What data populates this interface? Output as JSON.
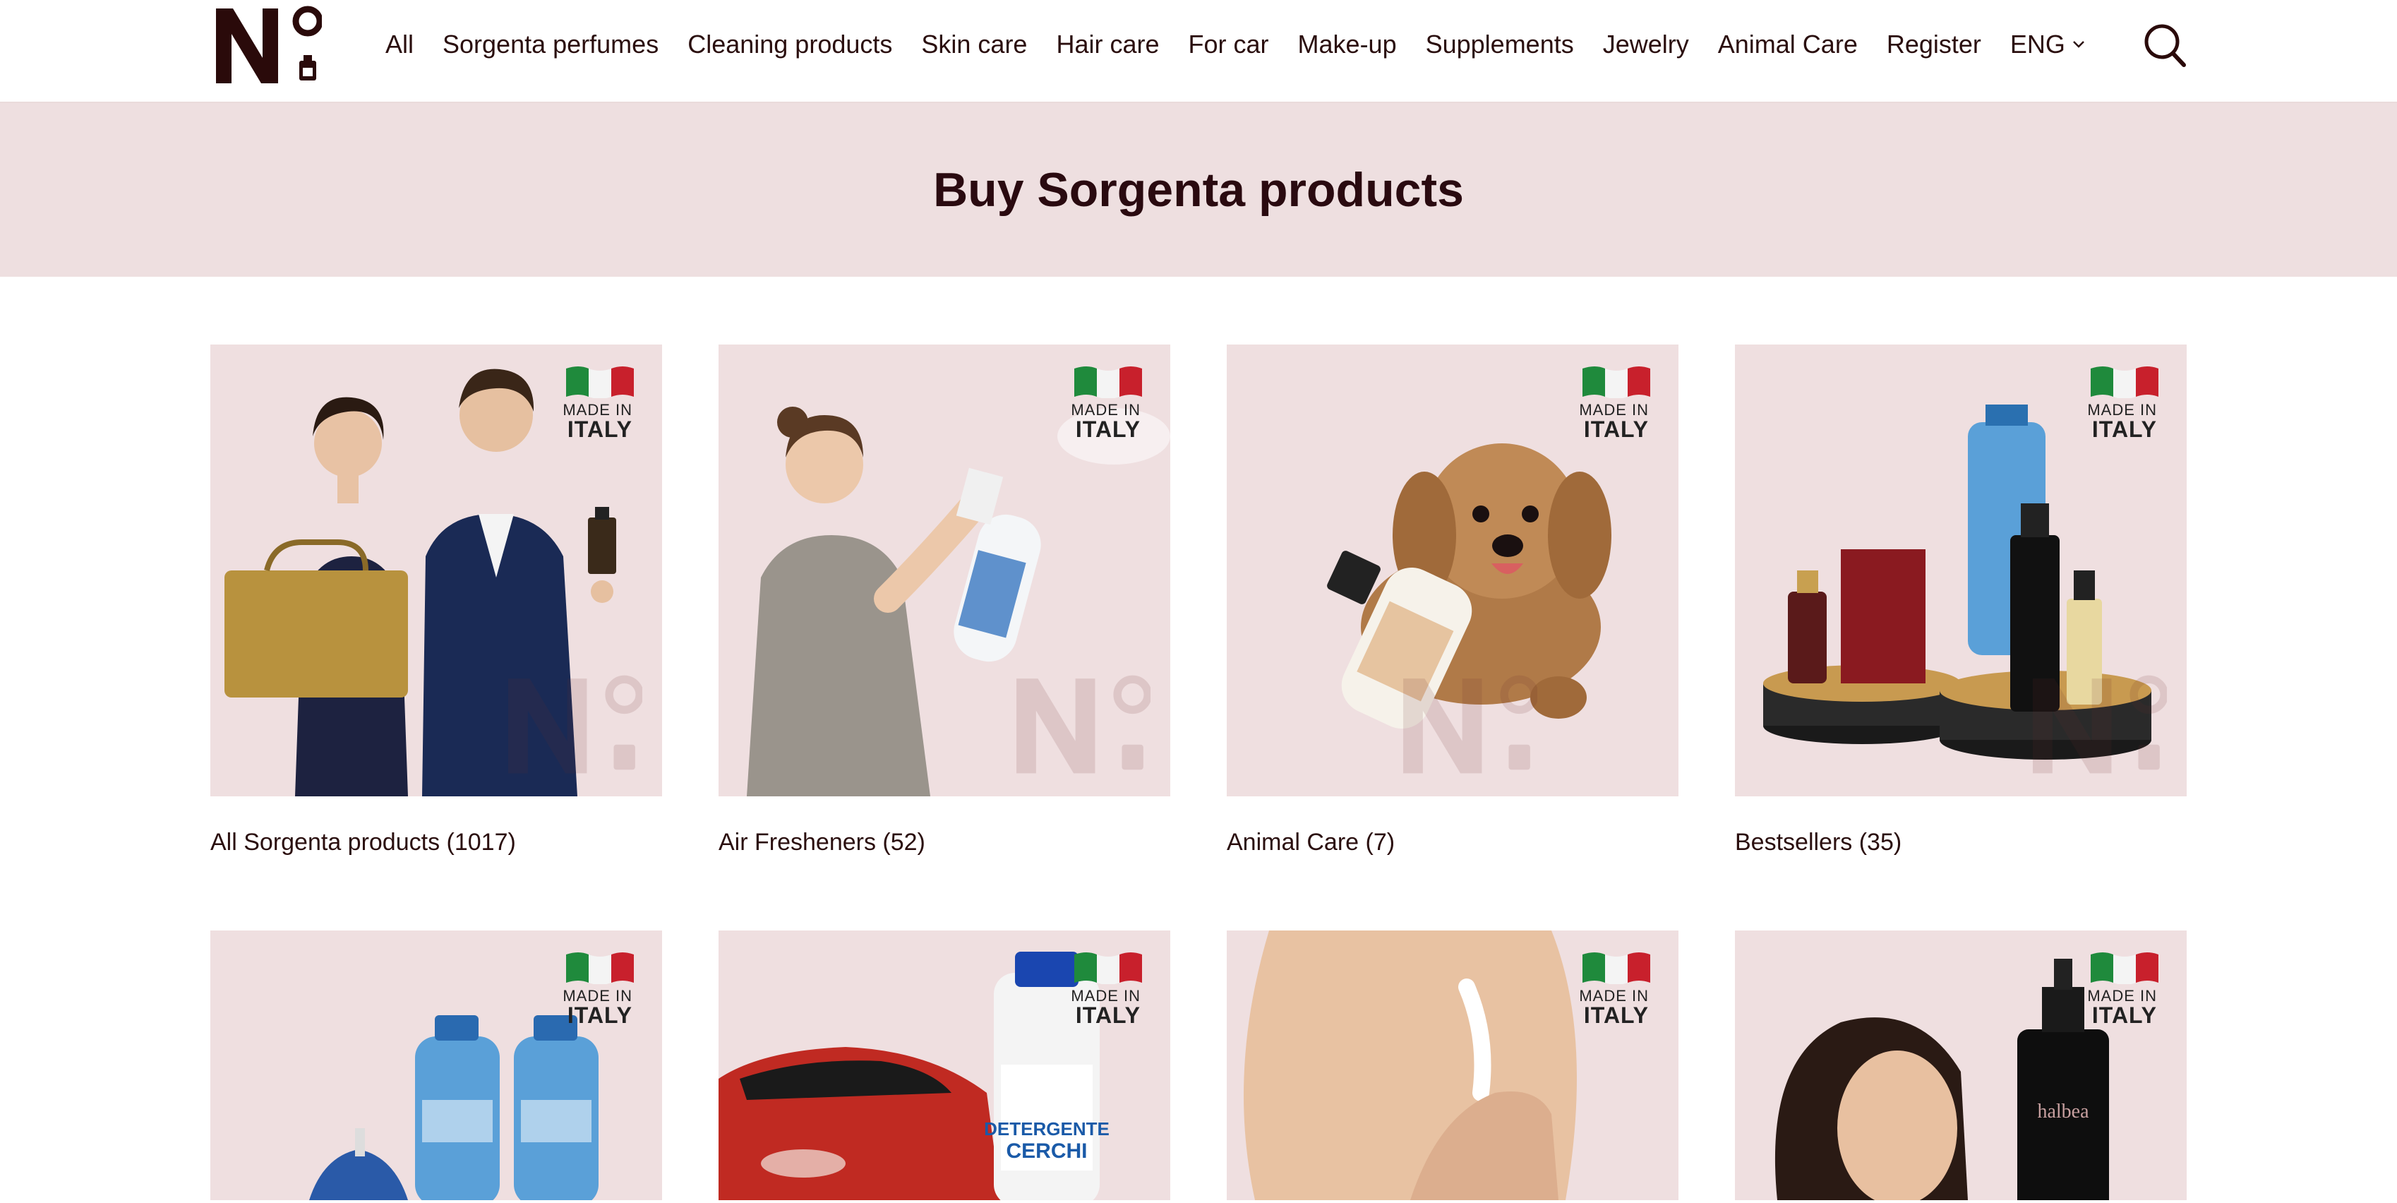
{
  "header": {
    "logo_text": "N°",
    "nav": [
      "All",
      "Sorgenta perfumes",
      "Cleaning products",
      "Skin care",
      "Hair care",
      "For car",
      "Make-up",
      "Supplements",
      "Jewelry",
      "Animal Care",
      "Register"
    ],
    "lang": "ENG"
  },
  "banner": {
    "title": "Buy Sorgenta products"
  },
  "badge": {
    "line1": "MADE IN",
    "line2": "ITALY"
  },
  "categories": [
    {
      "label": "All Sorgenta products (1017)",
      "illustration": "couple-with-perfume"
    },
    {
      "label": "Air Fresheners (52)",
      "illustration": "woman-spraying-freshener"
    },
    {
      "label": "Animal Care (7)",
      "illustration": "puppy-with-shampoo"
    },
    {
      "label": "Bestsellers (35)",
      "illustration": "perfume-bottles-on-stands"
    },
    {
      "label": "",
      "illustration": "cleaning-bottles-and-mop"
    },
    {
      "label": "",
      "illustration": "car-and-wheel-cleaner"
    },
    {
      "label": "",
      "illustration": "shoulder-with-lotion"
    },
    {
      "label": "",
      "illustration": "woman-with-hair-oil"
    }
  ],
  "colors": {
    "text": "#2a0e0e",
    "banner_bg": "#eedfe0",
    "card_bg": "#efdfe0"
  }
}
